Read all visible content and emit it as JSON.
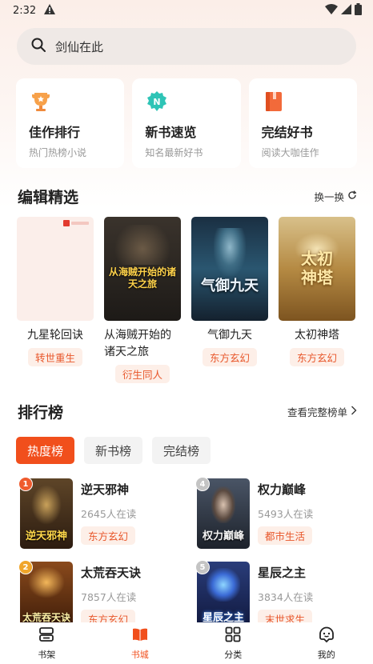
{
  "status_bar": {
    "time": "2:32"
  },
  "search": {
    "placeholder": "剑仙在此"
  },
  "features": [
    {
      "title": "佳作排行",
      "subtitle": "热门热榜小说",
      "icon": "trophy-icon"
    },
    {
      "title": "新书速览",
      "subtitle": "知名最新好书",
      "icon": "new-book-icon"
    },
    {
      "title": "完结好书",
      "subtitle": "阅读大咖佳作",
      "icon": "book-icon"
    }
  ],
  "editor_picks": {
    "title": "编辑精选",
    "refresh_label": "换一换",
    "books": [
      {
        "title": "九星轮回诀",
        "tag": "转世重生",
        "cover_color": "#fbeeea"
      },
      {
        "title": "从海贼开始的诸天之旅",
        "tag": "衍生同人",
        "cover_text": "从海贼开始的诸天之旅",
        "cover_color": "#2a2622"
      },
      {
        "title": "气御九天",
        "tag": "东方玄幻",
        "cover_text": "气御九天",
        "cover_color": "#1e3d52"
      },
      {
        "title": "太初神塔",
        "tag": "东方玄幻",
        "cover_text": "太初神塔",
        "cover_color": "#b58a43"
      }
    ]
  },
  "ranking": {
    "title": "排行榜",
    "view_all_label": "查看完整榜单",
    "tabs": [
      "热度榜",
      "新书榜",
      "完结榜"
    ],
    "items": [
      {
        "rank": "1",
        "title": "逆天邪神",
        "readers": "2645人在读",
        "tag": "东方玄幻",
        "cover_text": "逆天邪神",
        "cover_color": "#3d2a1a",
        "badge_color": "#ef5b2e"
      },
      {
        "rank": "4",
        "title": "权力巅峰",
        "readers": "5493人在读",
        "tag": "都市生活",
        "cover_text": "权力巅峰",
        "cover_color": "#2c3340",
        "badge_color": "#c4c4c4"
      },
      {
        "rank": "2",
        "title": "太荒吞天诀",
        "readers": "7857人在读",
        "tag": "东方玄幻",
        "cover_text": "太荒吞天诀",
        "cover_color": "#5a2c14",
        "badge_color": "#f0a52a"
      },
      {
        "rank": "5",
        "title": "星辰之主",
        "readers": "3834人在读",
        "tag": "末世求生",
        "cover_text": "星辰之主",
        "cover_color": "#1c2a55",
        "badge_color": "#c4c4c4"
      }
    ]
  },
  "bottom_nav": [
    {
      "label": "书架",
      "icon": "bookshelf-icon",
      "active": false
    },
    {
      "label": "书城",
      "icon": "bookstore-icon",
      "active": true
    },
    {
      "label": "分类",
      "icon": "category-icon",
      "active": false
    },
    {
      "label": "我的",
      "icon": "profile-icon",
      "active": false
    }
  ]
}
